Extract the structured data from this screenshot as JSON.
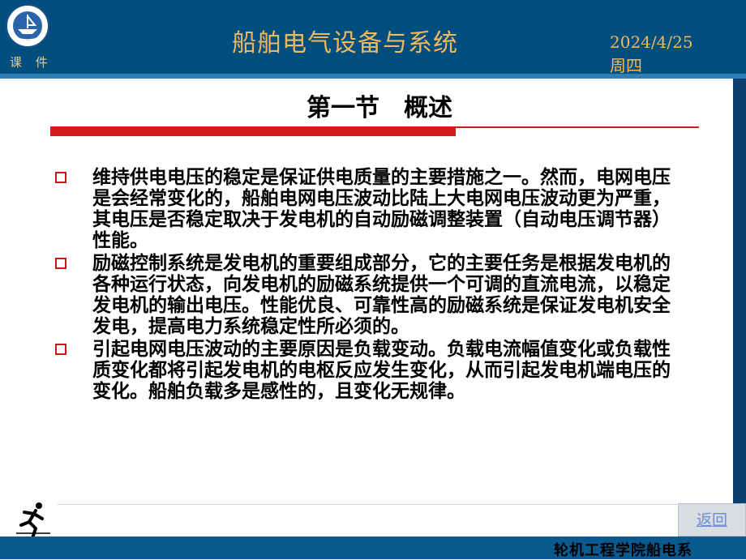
{
  "header": {
    "courseware_label": "课 件",
    "title": "船舶电气设备与系统",
    "date": "2024/4/25",
    "weekday": "周四"
  },
  "section": {
    "title": "第一节　概述"
  },
  "bullets": [
    {
      "text": "维持供电电压的稳定是保证供电质量的主要措施之一。然而，电网电压是会经常变化的，船舶电网电压波动比陆上大电网电压波动更为严重，其电压是否稳定取决于发电机的自动励磁调整装置（自动电压调节器）性能。"
    },
    {
      "text": "励磁控制系统是发电机的重要组成部分，它的主要任务是根据发电机的各种运行状态，向发电机的励磁系统提供一个可调的直流电流，以稳定发电机的输出电压。性能优良、可靠性高的励磁系统是保证发电机安全发电，提高电力系统稳定性所必须的。"
    },
    {
      "text": "引起电网电压波动的主要原因是负载变动。负载电流幅值变化或负载性质变化都将引起发电机的电枢反应发生变化，从而引起发电机端电压的变化。船舶负载多是感性的，且变化无规律。"
    }
  ],
  "navigation": {
    "back_label": "返回"
  },
  "footer": {
    "text": "轮机工程学院船电系"
  },
  "colors": {
    "header_bg": "#004e7e",
    "title_gold": "#f0b95f",
    "accent_red": "#d51c1c",
    "footer_bg": "#0a5a8f"
  },
  "icons": {
    "logo": "university-seal-icon",
    "runner": "runner-icon",
    "bullet": "hollow-square-bullet-icon"
  }
}
